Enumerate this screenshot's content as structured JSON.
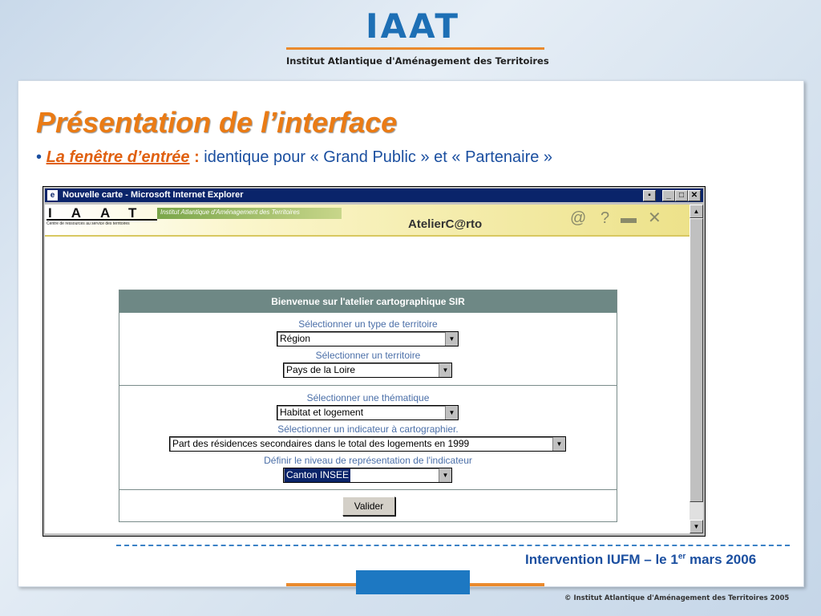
{
  "header": {
    "logo": "IAAT",
    "org_name": "Institut Atlantique d'Aménagement des Territoires"
  },
  "slide": {
    "title": "Présentation de l’interface",
    "bullet": "•",
    "subtitle_lead": "La fenêtre d’entrée",
    "subtitle_colon": " :",
    "subtitle_rest": " identique pour « Grand Public » et « Partenaire »"
  },
  "browser": {
    "title": "Nouvelle carte - Microsoft Internet Explorer",
    "banner": {
      "iaat_letters": "IAAT",
      "iaat_tagline": "Centre de ressources au service des territoires",
      "band_text": "Institut Atlantique d'Aménagement des Territoires",
      "app_name": "AtelierC@rto",
      "tools": [
        "@",
        "?",
        "▬",
        "✕"
      ]
    },
    "form": {
      "header": "Bienvenue sur l'atelier cartographique SIR",
      "label_territory_type": "Sélectionner un type de territoire",
      "territory_type_value": "Région",
      "label_territory": "Sélectionner un territoire",
      "territory_value": "Pays de la Loire",
      "label_theme": "Sélectionner une thématique",
      "theme_value": "Habitat et logement",
      "label_indicator": "Sélectionner un indicateur à cartographier.",
      "indicator_value": "Part des résidences secondaires dans le total des logements en 1999",
      "label_level": "Définir le niveau de représentation de l'indicateur",
      "level_value": "Canton INSEE",
      "submit_label": "Valider"
    }
  },
  "footer": {
    "intervention_a": "Intervention IUFM – le 1",
    "intervention_sup": "er",
    "intervention_b": " mars 2006",
    "copyright": "© Institut Atlantique d'Aménagement des Territoires 2005"
  },
  "colors": {
    "accent_orange": "#ea7b15",
    "brand_blue": "#1d6fb5",
    "form_header": "#6e8885"
  }
}
